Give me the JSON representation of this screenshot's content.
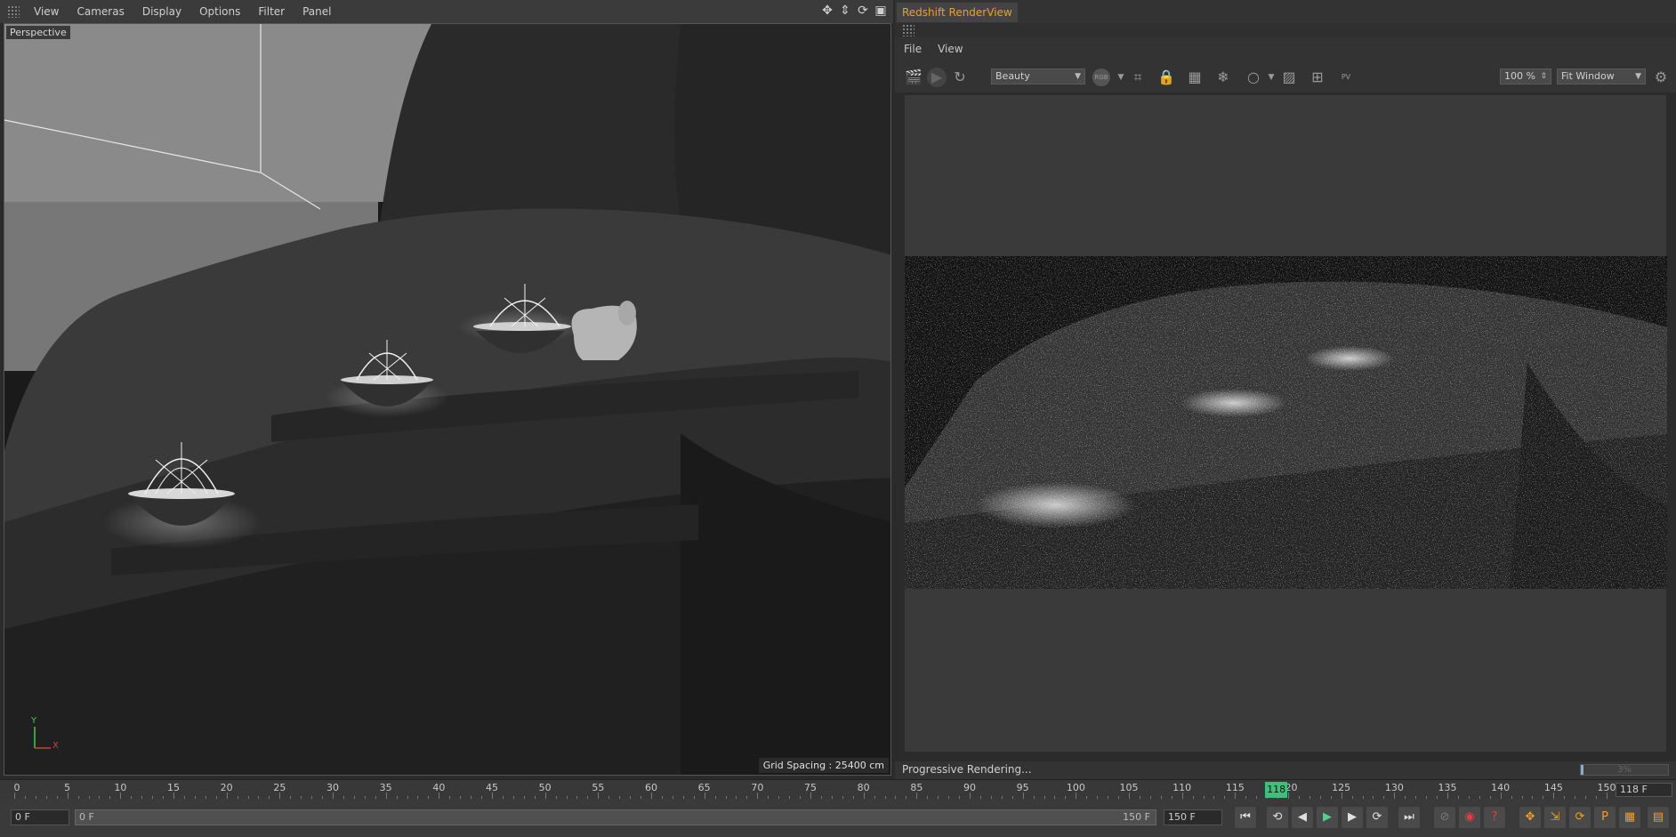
{
  "viewport": {
    "menu": [
      "View",
      "Cameras",
      "Display",
      "Options",
      "Filter",
      "Panel"
    ],
    "label": "Perspective",
    "grid_spacing": "Grid Spacing : 25400 cm",
    "axis_y": "Y",
    "axis_x": "X"
  },
  "renderview": {
    "title": "Redshift RenderView",
    "menu": [
      "File",
      "View"
    ],
    "aov_select": "Beauty",
    "rgb_label": "RGB",
    "pv_label": "PV",
    "zoom": "100 %",
    "fit_select": "Fit Window",
    "status": "Progressive Rendering...",
    "progress_percent": 3,
    "progress_label": "3%"
  },
  "timeline": {
    "ticks": [
      0,
      5,
      10,
      15,
      20,
      25,
      30,
      35,
      40,
      45,
      50,
      55,
      60,
      65,
      70,
      75,
      80,
      85,
      90,
      95,
      100,
      105,
      110,
      115,
      120,
      125,
      130,
      135,
      140,
      145,
      150
    ],
    "current_frame": 118,
    "current_marker_label": "118",
    "current_field": "118 F",
    "min_frame": 0,
    "max_frame": 150
  },
  "transport": {
    "start_field": "0 F",
    "range_start": "0 F",
    "range_end": "150 F",
    "end_field": "150 F"
  }
}
